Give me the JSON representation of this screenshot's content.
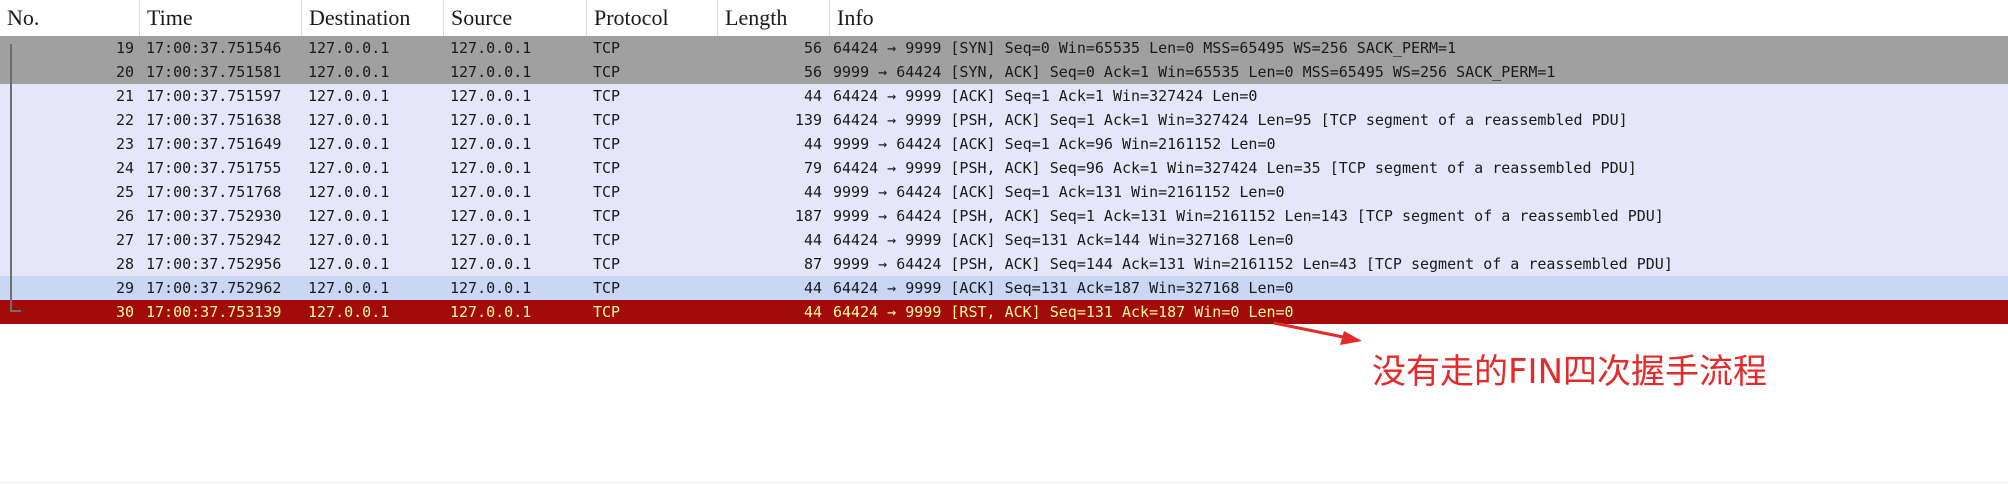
{
  "columns": {
    "no": "No.",
    "time": "Time",
    "destination": "Destination",
    "source": "Source",
    "protocol": "Protocol",
    "length": "Length",
    "info": "Info"
  },
  "packets": [
    {
      "no": "19",
      "time": "17:00:37.751546",
      "dst": "127.0.0.1",
      "src": "127.0.0.1",
      "proto": "TCP",
      "len": "56",
      "info": "64424 → 9999 [SYN] Seq=0 Win=65535 Len=0 MSS=65495 WS=256 SACK_PERM=1"
    },
    {
      "no": "20",
      "time": "17:00:37.751581",
      "dst": "127.0.0.1",
      "src": "127.0.0.1",
      "proto": "TCP",
      "len": "56",
      "info": "9999 → 64424 [SYN, ACK] Seq=0 Ack=1 Win=65535 Len=0 MSS=65495 WS=256 SACK_PERM=1"
    },
    {
      "no": "21",
      "time": "17:00:37.751597",
      "dst": "127.0.0.1",
      "src": "127.0.0.1",
      "proto": "TCP",
      "len": "44",
      "info": "64424 → 9999 [ACK] Seq=1 Ack=1 Win=327424 Len=0"
    },
    {
      "no": "22",
      "time": "17:00:37.751638",
      "dst": "127.0.0.1",
      "src": "127.0.0.1",
      "proto": "TCP",
      "len": "139",
      "info": "64424 → 9999 [PSH, ACK] Seq=1 Ack=1 Win=327424 Len=95 [TCP segment of a reassembled PDU]"
    },
    {
      "no": "23",
      "time": "17:00:37.751649",
      "dst": "127.0.0.1",
      "src": "127.0.0.1",
      "proto": "TCP",
      "len": "44",
      "info": "9999 → 64424 [ACK] Seq=1 Ack=96 Win=2161152 Len=0"
    },
    {
      "no": "24",
      "time": "17:00:37.751755",
      "dst": "127.0.0.1",
      "src": "127.0.0.1",
      "proto": "TCP",
      "len": "79",
      "info": "64424 → 9999 [PSH, ACK] Seq=96 Ack=1 Win=327424 Len=35 [TCP segment of a reassembled PDU]"
    },
    {
      "no": "25",
      "time": "17:00:37.751768",
      "dst": "127.0.0.1",
      "src": "127.0.0.1",
      "proto": "TCP",
      "len": "44",
      "info": "9999 → 64424 [ACK] Seq=1 Ack=131 Win=2161152 Len=0"
    },
    {
      "no": "26",
      "time": "17:00:37.752930",
      "dst": "127.0.0.1",
      "src": "127.0.0.1",
      "proto": "TCP",
      "len": "187",
      "info": "9999 → 64424 [PSH, ACK] Seq=1 Ack=131 Win=2161152 Len=143 [TCP segment of a reassembled PDU]"
    },
    {
      "no": "27",
      "time": "17:00:37.752942",
      "dst": "127.0.0.1",
      "src": "127.0.0.1",
      "proto": "TCP",
      "len": "44",
      "info": "64424 → 9999 [ACK] Seq=131 Ack=144 Win=327168 Len=0"
    },
    {
      "no": "28",
      "time": "17:00:37.752956",
      "dst": "127.0.0.1",
      "src": "127.0.0.1",
      "proto": "TCP",
      "len": "87",
      "info": "9999 → 64424 [PSH, ACK] Seq=144 Ack=131 Win=2161152 Len=43 [TCP segment of a reassembled PDU]"
    },
    {
      "no": "29",
      "time": "17:00:37.752962",
      "dst": "127.0.0.1",
      "src": "127.0.0.1",
      "proto": "TCP",
      "len": "44",
      "info": "64424 → 9999 [ACK] Seq=131 Ack=187 Win=327168 Len=0"
    },
    {
      "no": "30",
      "time": "17:00:37.753139",
      "dst": "127.0.0.1",
      "src": "127.0.0.1",
      "proto": "TCP",
      "len": "44",
      "info": "64424 → 9999 [RST, ACK] Seq=131 Ack=187 Win=0 Len=0"
    }
  ],
  "annotation": {
    "text": "没有走的FIN四次握手流程",
    "color": "#e52a2a"
  },
  "colors": {
    "syn_row": "#a0a0a0",
    "normal_row": "#e6e6fa",
    "selected_row": "#c9d7f5",
    "rst_row": "#a30a0a",
    "rst_text": "#fffc9c"
  }
}
